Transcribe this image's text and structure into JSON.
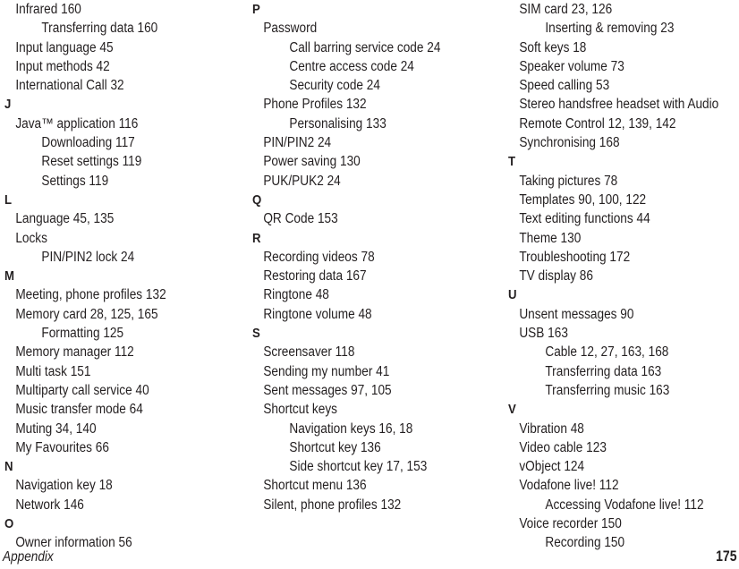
{
  "document": {
    "type": "printed-index",
    "footer_label": "Appendix",
    "page_number": "175",
    "text_color": "#231f20",
    "background_color": "#ffffff"
  },
  "columns": [
    {
      "id": "column-1",
      "blocks": [
        {
          "letter": null,
          "entries": [
            {
              "level": 1,
              "text": "Infrared 160"
            },
            {
              "level": 2,
              "text": "Transferring data 160"
            },
            {
              "level": 1,
              "text": "Input language 45"
            },
            {
              "level": 1,
              "text": "Input methods 42"
            },
            {
              "level": 1,
              "text": "International Call 32"
            }
          ]
        },
        {
          "letter": "J",
          "entries": [
            {
              "level": 1,
              "text": "Java™ application 116"
            },
            {
              "level": 2,
              "text": "Downloading 117"
            },
            {
              "level": 2,
              "text": "Reset settings 119"
            },
            {
              "level": 2,
              "text": "Settings 119"
            }
          ]
        },
        {
          "letter": "L",
          "entries": [
            {
              "level": 1,
              "text": "Language 45, 135"
            },
            {
              "level": 1,
              "text": "Locks"
            },
            {
              "level": 2,
              "text": "PIN/PIN2 lock 24"
            }
          ]
        },
        {
          "letter": "M",
          "entries": [
            {
              "level": 1,
              "text": "Meeting, phone profiles 132"
            },
            {
              "level": 1,
              "text": "Memory card 28, 125, 165"
            },
            {
              "level": 2,
              "text": "Formatting 125"
            },
            {
              "level": 1,
              "text": "Memory manager 112"
            },
            {
              "level": 1,
              "text": "Multi task 151"
            },
            {
              "level": 1,
              "text": "Multiparty call service 40"
            },
            {
              "level": 1,
              "text": "Music transfer mode 64"
            },
            {
              "level": 1,
              "text": "Muting 34, 140"
            },
            {
              "level": 1,
              "text": "My Favourites 66"
            }
          ]
        },
        {
          "letter": "N",
          "entries": [
            {
              "level": 1,
              "text": "Navigation key 18"
            },
            {
              "level": 1,
              "text": "Network 146"
            }
          ]
        },
        {
          "letter": "O",
          "entries": [
            {
              "level": 1,
              "text": "Owner information 56"
            }
          ]
        }
      ]
    },
    {
      "id": "column-2",
      "blocks": [
        {
          "letter": "P",
          "entries": [
            {
              "level": 1,
              "text": "Password"
            },
            {
              "level": 2,
              "text": "Call barring service code 24"
            },
            {
              "level": 2,
              "text": "Centre access code 24"
            },
            {
              "level": 2,
              "text": "Security code 24"
            },
            {
              "level": 1,
              "text": "Phone Profiles 132"
            },
            {
              "level": 2,
              "text": "Personalising 133"
            },
            {
              "level": 1,
              "text": "PIN/PIN2 24"
            },
            {
              "level": 1,
              "text": "Power saving 130"
            },
            {
              "level": 1,
              "text": "PUK/PUK2 24"
            }
          ]
        },
        {
          "letter": "Q",
          "entries": [
            {
              "level": 1,
              "text": "QR Code 153"
            }
          ]
        },
        {
          "letter": "R",
          "entries": [
            {
              "level": 1,
              "text": "Recording videos 78"
            },
            {
              "level": 1,
              "text": "Restoring data 167"
            },
            {
              "level": 1,
              "text": "Ringtone 48"
            },
            {
              "level": 1,
              "text": "Ringtone volume 48"
            }
          ]
        },
        {
          "letter": "S",
          "entries": [
            {
              "level": 1,
              "text": "Screensaver 118"
            },
            {
              "level": 1,
              "text": "Sending my number 41"
            },
            {
              "level": 1,
              "text": "Sent messages 97, 105"
            },
            {
              "level": 1,
              "text": "Shortcut keys"
            },
            {
              "level": 2,
              "text": "Navigation keys 16, 18"
            },
            {
              "level": 2,
              "text": "Shortcut key 136"
            },
            {
              "level": 2,
              "text": "Side shortcut key 17, 153"
            },
            {
              "level": 1,
              "text": "Shortcut menu 136"
            },
            {
              "level": 1,
              "text": "Silent, phone profiles 132"
            }
          ]
        }
      ]
    },
    {
      "id": "column-3",
      "blocks": [
        {
          "letter": null,
          "entries": [
            {
              "level": 1,
              "text": "SIM card 23, 126"
            },
            {
              "level": 2,
              "text": "Inserting & removing 23"
            },
            {
              "level": 1,
              "text": "Soft keys 18"
            },
            {
              "level": 1,
              "text": "Speaker volume 73"
            },
            {
              "level": 1,
              "text": "Speed calling 53"
            },
            {
              "level": 1,
              "text": "Stereo handsfree headset with Audio"
            },
            {
              "level": 1,
              "text": "Remote Control 12, 139, 142"
            },
            {
              "level": 1,
              "text": "Synchronising 168"
            }
          ]
        },
        {
          "letter": "T",
          "entries": [
            {
              "level": 1,
              "text": "Taking pictures 78"
            },
            {
              "level": 1,
              "text": "Templates 90, 100, 122"
            },
            {
              "level": 1,
              "text": "Text editing functions 44"
            },
            {
              "level": 1,
              "text": "Theme 130"
            },
            {
              "level": 1,
              "text": "Troubleshooting 172"
            },
            {
              "level": 1,
              "text": "TV display 86"
            }
          ]
        },
        {
          "letter": "U",
          "entries": [
            {
              "level": 1,
              "text": "Unsent messages 90"
            },
            {
              "level": 1,
              "text": "USB 163"
            },
            {
              "level": 2,
              "text": "Cable 12, 27, 163, 168"
            },
            {
              "level": 2,
              "text": "Transferring data 163"
            },
            {
              "level": 2,
              "text": "Transferring music 163"
            }
          ]
        },
        {
          "letter": "V",
          "entries": [
            {
              "level": 1,
              "text": "Vibration 48"
            },
            {
              "level": 1,
              "text": "Video cable 123"
            },
            {
              "level": 1,
              "text": "vObject 124"
            },
            {
              "level": 1,
              "text": "Vodafone live! 112"
            },
            {
              "level": 2,
              "text": "Accessing Vodafone live! 112"
            },
            {
              "level": 1,
              "text": "Voice recorder 150"
            },
            {
              "level": 2,
              "text": "Recording 150"
            }
          ]
        }
      ]
    }
  ]
}
